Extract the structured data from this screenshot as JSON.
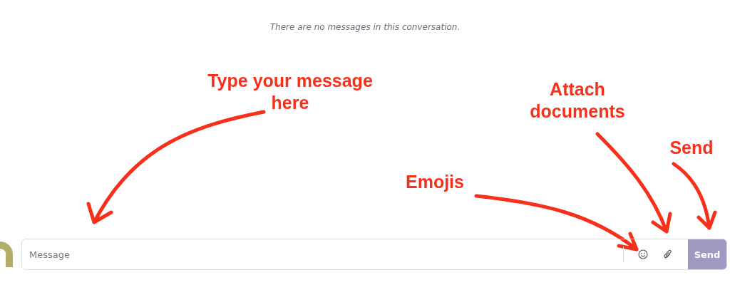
{
  "empty_notice": "There are no messages in this conversation.",
  "annotations": [
    {
      "label": "Type your message\nhere",
      "kind": "input"
    },
    {
      "label": "Emojis",
      "kind": "emoji"
    },
    {
      "label": "Attach\ndocuments",
      "kind": "attach"
    },
    {
      "label": "Send",
      "kind": "send"
    }
  ],
  "composer": {
    "placeholder": "Message",
    "send_label": "Send"
  }
}
